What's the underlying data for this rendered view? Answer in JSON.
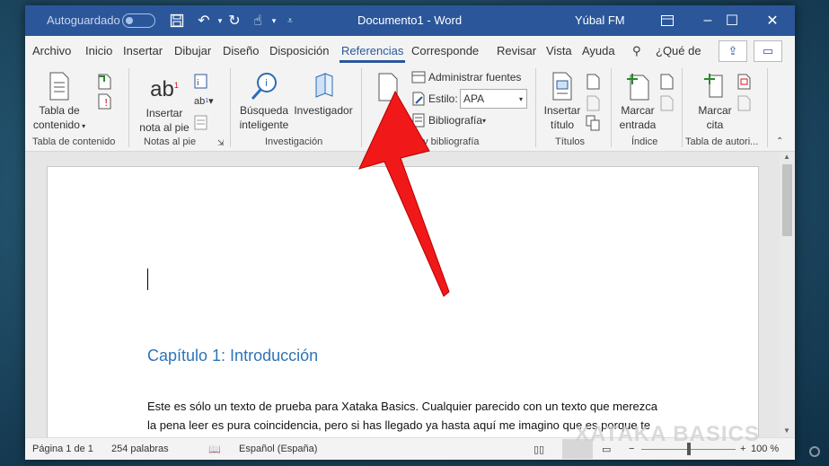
{
  "titlebar": {
    "autosave_label": "Autoguardado",
    "doc_title": "Documento1  -  Word",
    "user": "Yúbal FM"
  },
  "tabs": [
    "Archivo",
    "Inicio",
    "Insertar",
    "Dibujar",
    "Diseño",
    "Disposición",
    "Referencias",
    "Corresponde",
    "Revisar",
    "Vista",
    "Ayuda"
  ],
  "active_tab": "Referencias",
  "tell_me": "¿Qué de",
  "ribbon": {
    "toc_button": [
      "Tabla de",
      "contenido"
    ],
    "footnote_button": [
      "Insertar",
      "nota al pie"
    ],
    "smart_lookup_button": [
      "Búsqueda",
      "inteligente"
    ],
    "researcher_button": "Investigador",
    "manage_sources": "Administrar fuentes",
    "style_label": "Estilo:",
    "style_value": "APA",
    "bibliography": "Bibliografía",
    "caption_button": [
      "Insertar",
      "título"
    ],
    "mark_entry_button": [
      "Marcar",
      "entrada"
    ],
    "mark_citation_button": [
      "Marcar",
      "cita"
    ],
    "groups": [
      "Tabla de contenido",
      "Notas al pie",
      "Investigación",
      "Citas y bibliografía",
      "Títulos",
      "Índice",
      "Tabla de autori..."
    ]
  },
  "document": {
    "heading": "Capítulo 1: Introducción",
    "paragraph": "Este es sólo un texto de prueba para Xataka Basics. Cualquier parecido con un texto que merezca la pena leer es pura coincidencia, pero si has llegado ya hasta aquí me imagino que es porque te puede la curiosidad. No seré yo quien te diga que dejes de leer, pero recuerda que"
  },
  "status": {
    "page": "Página 1 de 1",
    "words": "254 palabras",
    "language": "Español (España)",
    "zoom": "100 %",
    "zoom_level": 1.0
  },
  "watermark": "XATAKA BASICS",
  "colors": {
    "word_blue": "#2b579a",
    "heading_blue": "#2e74b5",
    "arrow_red": "#f01818"
  }
}
